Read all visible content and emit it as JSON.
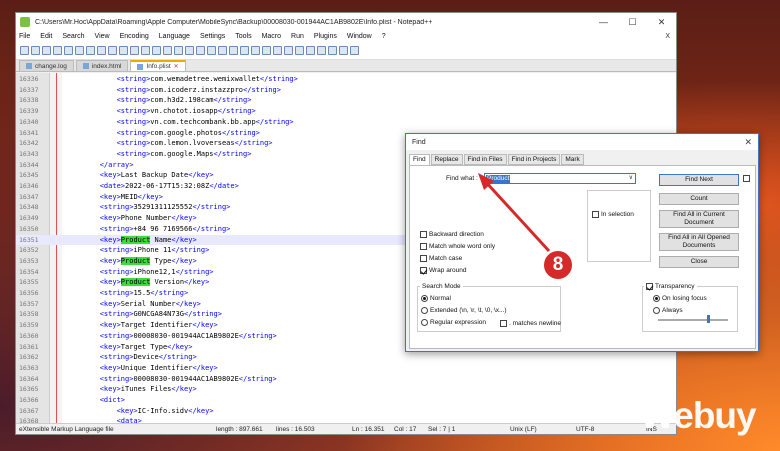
{
  "window": {
    "title": "C:\\Users\\Mr.Hoc\\AppData\\Roaming\\Apple Computer\\MobileSync\\Backup\\00008030-001944AC1AB9802E\\Info.plist - Notepad++",
    "minimize": "—",
    "maximize": "☐",
    "close": "✕"
  },
  "menu": [
    "File",
    "Edit",
    "Search",
    "View",
    "Encoding",
    "Language",
    "Settings",
    "Tools",
    "Macro",
    "Run",
    "Plugins",
    "Window",
    "?"
  ],
  "menu_close": "X",
  "tabs": [
    {
      "label": "change.log"
    },
    {
      "label": "index.html"
    },
    {
      "label": "Info.plist"
    }
  ],
  "lines": [
    {
      "n": "16336",
      "ind": "            ",
      "pre": "<string>",
      "txt": "com.wemadetree.wemixwallet",
      "post": "</string>"
    },
    {
      "n": "16337",
      "ind": "            ",
      "pre": "<string>",
      "txt": "com.icoderz.instazzpro",
      "post": "</string>"
    },
    {
      "n": "16338",
      "ind": "            ",
      "pre": "<string>",
      "txt": "com.h3d2.198cam",
      "post": "</string>"
    },
    {
      "n": "16339",
      "ind": "            ",
      "pre": "<string>",
      "txt": "vn.chotot.iosapp",
      "post": "</string>"
    },
    {
      "n": "16340",
      "ind": "            ",
      "pre": "<string>",
      "txt": "vn.com.techcombank.bb.app",
      "post": "</string>"
    },
    {
      "n": "16341",
      "ind": "            ",
      "pre": "<string>",
      "txt": "com.google.photos",
      "post": "</string>"
    },
    {
      "n": "16342",
      "ind": "            ",
      "pre": "<string>",
      "txt": "com.lemon.lvoverseas",
      "post": "</string>"
    },
    {
      "n": "16343",
      "ind": "            ",
      "pre": "<string>",
      "txt": "com.google.Maps",
      "post": "</string>"
    },
    {
      "n": "16344",
      "ind": "        ",
      "pre": "</array>",
      "txt": "",
      "post": ""
    },
    {
      "n": "16345",
      "ind": "        ",
      "pre": "<key>",
      "txt": "Last Backup Date",
      "post": "</key>"
    },
    {
      "n": "16346",
      "ind": "        ",
      "pre": "<date>",
      "txt": "2022-06-17T15:32:08Z",
      "post": "</date>"
    },
    {
      "n": "16347",
      "ind": "        ",
      "pre": "<key>",
      "txt": "MEID",
      "post": "</key>"
    },
    {
      "n": "16348",
      "ind": "        ",
      "pre": "<string>",
      "txt": "35291311125552",
      "post": "</string>"
    },
    {
      "n": "16349",
      "ind": "        ",
      "pre": "<key>",
      "txt": "Phone Number",
      "post": "</key>"
    },
    {
      "n": "16350",
      "ind": "        ",
      "pre": "<string>",
      "txt": "+84 96 7169566",
      "post": "</string>"
    },
    {
      "n": "16351",
      "ind": "        ",
      "pre": "<key>",
      "hl": "Product",
      "txt": " Name",
      "post": "</key>"
    },
    {
      "n": "16352",
      "ind": "        ",
      "pre": "<string>",
      "txt": "iPhone 11",
      "post": "</string>"
    },
    {
      "n": "16353",
      "ind": "        ",
      "pre": "<key>",
      "hl": "Product",
      "txt": " Type",
      "post": "</key>"
    },
    {
      "n": "16354",
      "ind": "        ",
      "pre": "<string>",
      "txt": "iPhone12,1",
      "post": "</string>"
    },
    {
      "n": "16355",
      "ind": "        ",
      "pre": "<key>",
      "hl": "Product",
      "txt": " Version",
      "post": "</key>"
    },
    {
      "n": "16356",
      "ind": "        ",
      "pre": "<string>",
      "txt": "15.5",
      "post": "</string>"
    },
    {
      "n": "16357",
      "ind": "        ",
      "pre": "<key>",
      "txt": "Serial Number",
      "post": "</key>"
    },
    {
      "n": "16358",
      "ind": "        ",
      "pre": "<string>",
      "txt": "G0NCGA84N73G",
      "post": "</string>"
    },
    {
      "n": "16359",
      "ind": "        ",
      "pre": "<key>",
      "txt": "Target Identifier",
      "post": "</key>"
    },
    {
      "n": "16360",
      "ind": "        ",
      "pre": "<string>",
      "txt": "00008030-001944AC1AB9802E",
      "post": "</string>"
    },
    {
      "n": "16361",
      "ind": "        ",
      "pre": "<key>",
      "txt": "Target Type",
      "post": "</key>"
    },
    {
      "n": "16362",
      "ind": "        ",
      "pre": "<string>",
      "txt": "Device",
      "post": "</string>"
    },
    {
      "n": "16363",
      "ind": "        ",
      "pre": "<key>",
      "txt": "Unique Identifier",
      "post": "</key>"
    },
    {
      "n": "16364",
      "ind": "        ",
      "pre": "<string>",
      "txt": "00008030-001944AC1AB9802E",
      "post": "</string>"
    },
    {
      "n": "16365",
      "ind": "        ",
      "pre": "<key>",
      "txt": "iTunes Files",
      "post": "</key>"
    },
    {
      "n": "16366",
      "ind": "        ",
      "pre": "<dict>",
      "txt": "",
      "post": ""
    },
    {
      "n": "16367",
      "ind": "            ",
      "pre": "<key>",
      "txt": "IC-Info.sidv",
      "post": "</key>"
    },
    {
      "n": "16368",
      "ind": "            ",
      "pre": "<data>",
      "txt": "",
      "post": ""
    }
  ],
  "status": {
    "lang": "eXtensible Markup Language file",
    "length": "length : 897.661",
    "lines": "lines : 16.503",
    "ln": "Ln : 16.351",
    "col": "Col : 17",
    "sel": "Sel : 7 | 1",
    "eol": "Unix (LF)",
    "enc": "UTF-8",
    "ins": "INS"
  },
  "find": {
    "title": "Find",
    "close": "✕",
    "tabs": [
      "Find",
      "Replace",
      "Find in Files",
      "Find in Projects",
      "Mark"
    ],
    "find_what_label": "Find what :",
    "find_what_value": "Product",
    "in_selection": "In selection",
    "buttons": {
      "find_next": "Find Next",
      "count": "Count",
      "find_all_current": "Find All in Current Document",
      "find_all_opened": "Find All in All Opened Documents",
      "close": "Close"
    },
    "options": [
      {
        "label": "Backward direction",
        "on": false
      },
      {
        "label": "Match whole word only",
        "on": false
      },
      {
        "label": "Match case",
        "on": false
      },
      {
        "label": "Wrap around",
        "on": true
      }
    ],
    "search_mode": {
      "title": "Search Mode",
      "normal": "Normal",
      "extended": "Extended (\\n, \\r, \\t, \\0, \\x...)",
      "regex": "Regular expression",
      "matches_newline": ". matches newline"
    },
    "transparency": {
      "label": "Transparency",
      "on_losing_focus": "On losing focus",
      "always": "Always",
      "level": 0.8
    }
  },
  "annotation": {
    "step": "8",
    "color": "#d42a2a"
  },
  "watermark": "Webuy"
}
